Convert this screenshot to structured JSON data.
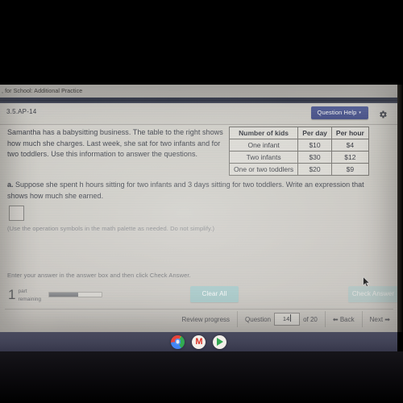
{
  "browser": {
    "tab_title": ", for School: Additional Practice"
  },
  "exercise": {
    "id": "3.5.AP-14",
    "help_button": "Question Help",
    "help_caret": "▾",
    "settings_icon": "gear-icon"
  },
  "question": {
    "stem": "Samantha has a babysitting business. The table to the right shows how much she charges. Last week, she sat for two infants and for two toddlers. Use this information to answer the questions.",
    "part_label": "a.",
    "part_text": "Suppose she spent h hours sitting for two infants and 3 days sitting for two toddlers. Write an expression that shows how much she earned.",
    "answer_value": "",
    "answer_placeholder": "",
    "hint": "(Use the operation symbols in the math palette as needed. Do not simplify.)"
  },
  "table": {
    "headers": [
      "Number of kids",
      "Per day",
      "Per hour"
    ],
    "rows": [
      [
        "One infant",
        "$10",
        "$4"
      ],
      [
        "Two infants",
        "$30",
        "$12"
      ],
      [
        "One or two toddlers",
        "$20",
        "$9"
      ]
    ]
  },
  "footer": {
    "instruction": "Enter your answer in the answer box and then click Check Answer.",
    "parts_remaining_count": "1",
    "parts_remaining_line1": "part",
    "parts_remaining_line2": "remaining",
    "progress_percent": "55",
    "clear_all": "Clear All",
    "check_answer": "Check Answer"
  },
  "nav": {
    "review_progress": "Review progress",
    "question_label": "Question",
    "question_number": "14",
    "of_label": "of 20",
    "back_arrow": "⬅",
    "back_label": "Back",
    "next_label": "Next",
    "next_arrow": "➡"
  },
  "shelf": {
    "icons": [
      {
        "name": "chrome-icon",
        "label": "Chrome"
      },
      {
        "name": "gmail-icon",
        "label": "Gmail"
      },
      {
        "name": "play-store-icon",
        "label": "Play Store"
      }
    ]
  },
  "colors": {
    "help_button": "#35459b",
    "navy_band": "#1e2640",
    "teal_button": "#8acdd2",
    "screen_bg": "#cfcbc3",
    "shelf_bg": "#414256"
  }
}
